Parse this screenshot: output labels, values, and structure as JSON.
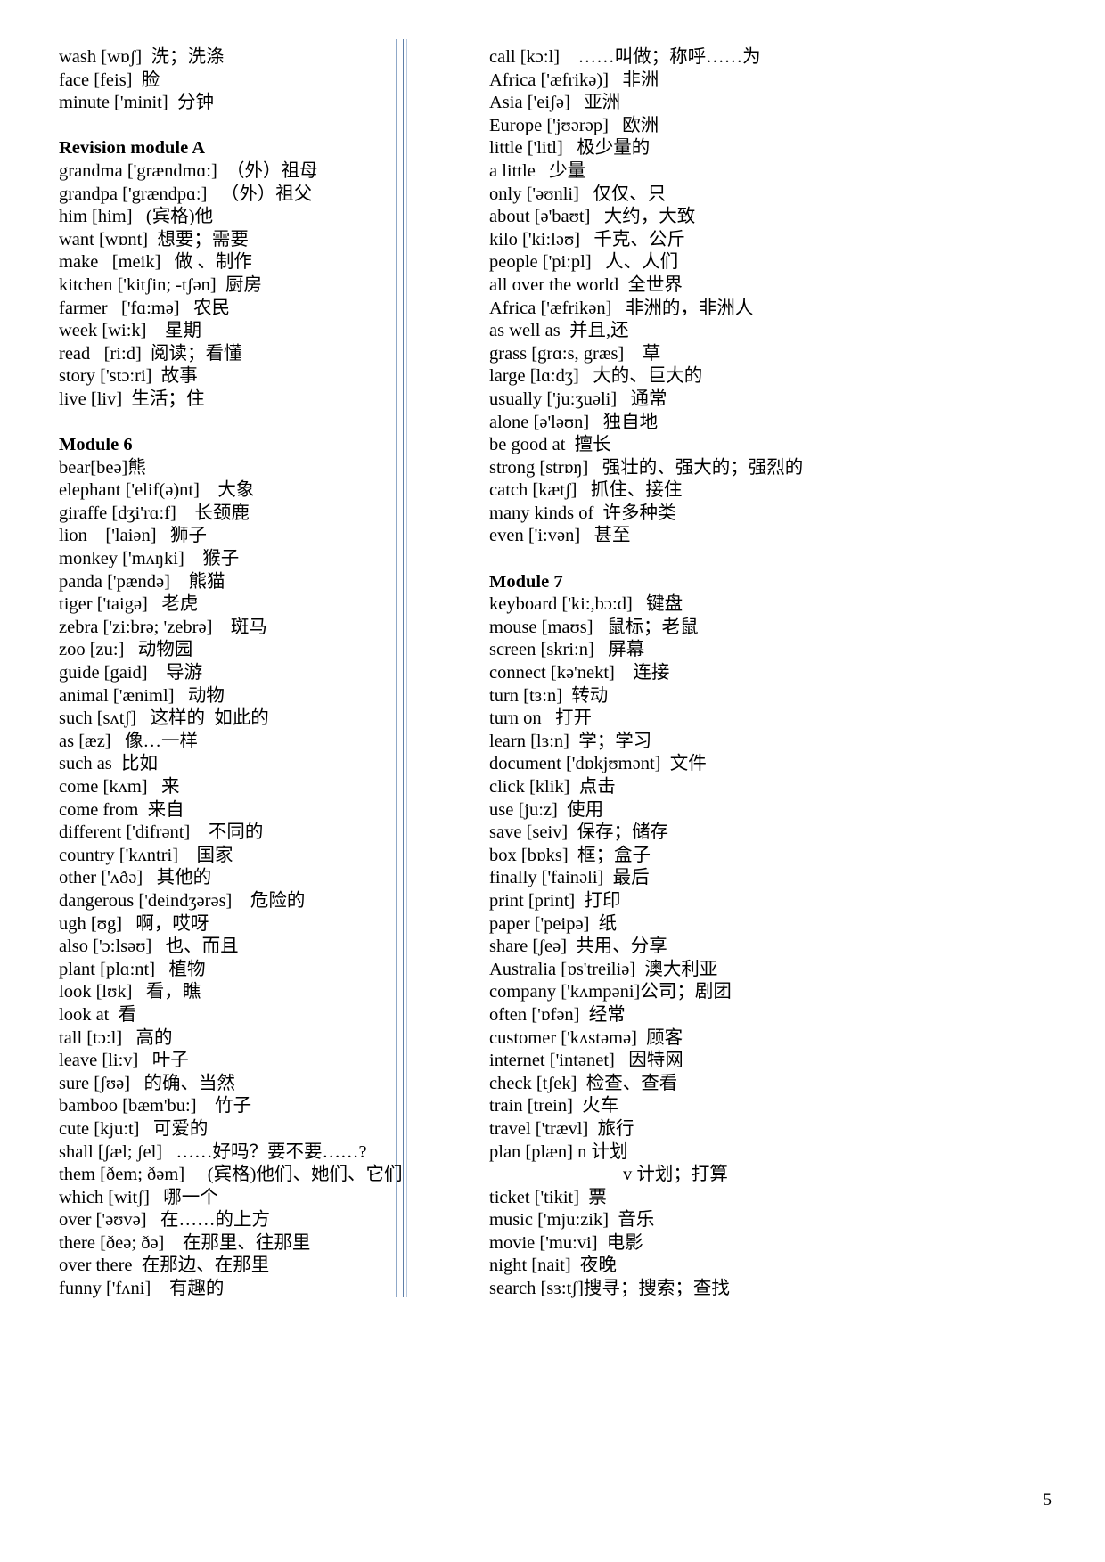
{
  "document": {
    "page_number": "5",
    "left_column": [
      {
        "type": "entry",
        "text": "wash [wɒʃ]  洗；洗涤"
      },
      {
        "type": "entry",
        "text": "face [feis]  脸"
      },
      {
        "type": "entry",
        "text": "minute ['minit]  分钟"
      },
      {
        "type": "spacer",
        "text": ""
      },
      {
        "type": "heading",
        "text": "Revision module A"
      },
      {
        "type": "entry",
        "text": "grandma ['grændmɑ:]  （外）祖母"
      },
      {
        "type": "entry",
        "text": "grandpa ['grændpɑ:]   （外）祖父"
      },
      {
        "type": "entry",
        "text": "him [him]   (宾格)他"
      },
      {
        "type": "entry",
        "text": "want [wɒnt]  想要；需要"
      },
      {
        "type": "entry",
        "text": "make   [meik]   做 、制作"
      },
      {
        "type": "entry",
        "text": "kitchen ['kitʃin; -tʃən]  厨房"
      },
      {
        "type": "entry",
        "text": "farmer   ['fɑ:mə]   农民"
      },
      {
        "type": "entry",
        "text": "week [wi:k]    星期"
      },
      {
        "type": "entry",
        "text": "read   [ri:d]  阅读；看懂"
      },
      {
        "type": "entry",
        "text": "story ['stɔ:ri]  故事"
      },
      {
        "type": "entry",
        "text": "live [liv]  生活；住"
      },
      {
        "type": "spacer",
        "text": ""
      },
      {
        "type": "heading",
        "text": "Module 6"
      },
      {
        "type": "entry",
        "text": "bear[beə]熊"
      },
      {
        "type": "entry",
        "text": "elephant ['elif(ə)nt]    大象"
      },
      {
        "type": "entry",
        "text": "giraffe [dʒi'rɑ:f]    长颈鹿"
      },
      {
        "type": "entry",
        "text": "lion    ['laiən]   狮子"
      },
      {
        "type": "entry",
        "text": "monkey ['mʌŋki]    猴子"
      },
      {
        "type": "entry",
        "text": "panda ['pændə]    熊猫"
      },
      {
        "type": "entry",
        "text": "tiger ['taigə]   老虎"
      },
      {
        "type": "entry",
        "text": "zebra ['zi:brə; 'zebrə]    斑马"
      },
      {
        "type": "entry",
        "text": "zoo [zu:]   动物园"
      },
      {
        "type": "entry",
        "text": "guide [gaid]    导游"
      },
      {
        "type": "entry",
        "text": "animal ['æniml]   动物"
      },
      {
        "type": "entry",
        "text": "such [sʌtʃ]   这样的  如此的"
      },
      {
        "type": "entry",
        "text": "as [æz]   像…一样"
      },
      {
        "type": "entry",
        "text": "such as  比如"
      },
      {
        "type": "entry",
        "text": "come [kʌm]   来"
      },
      {
        "type": "entry",
        "text": "come from  来自"
      },
      {
        "type": "entry",
        "text": "different ['difrənt]    不同的"
      },
      {
        "type": "entry",
        "text": "country ['kʌntri]    国家"
      },
      {
        "type": "entry",
        "text": "other ['ʌðə]   其他的"
      },
      {
        "type": "entry",
        "text": "dangerous ['deindʒərəs]    危险的"
      },
      {
        "type": "entry",
        "text": "ugh [ʊg]   啊，哎呀"
      },
      {
        "type": "entry",
        "text": "also ['ɔ:lsəʊ]   也、而且"
      },
      {
        "type": "entry",
        "text": "plant [plɑ:nt]   植物"
      },
      {
        "type": "entry",
        "text": "look [lʊk]   看，瞧"
      },
      {
        "type": "entry",
        "text": "look at  看"
      },
      {
        "type": "entry",
        "text": "tall [tɔ:l]   高的"
      },
      {
        "type": "entry",
        "text": "leave [li:v]   叶子"
      },
      {
        "type": "entry",
        "text": "sure [ʃʊə]   的确、当然"
      },
      {
        "type": "entry",
        "text": "bamboo [bæm'bu:]    竹子"
      },
      {
        "type": "entry",
        "text": "cute [kju:t]   可爱的"
      },
      {
        "type": "entry",
        "text": "shall [ʃæl; ʃel]   ……好吗？要不要……?"
      },
      {
        "type": "entry",
        "text": "them [ðem; ðəm]     (宾格)他们、她们、它们"
      },
      {
        "type": "entry",
        "text": "which [witʃ]   哪一个"
      },
      {
        "type": "entry",
        "text": "over ['əʊvə]   在……的上方"
      },
      {
        "type": "entry",
        "text": "there [ðeə; ðə]    在那里、往那里"
      },
      {
        "type": "entry",
        "text": "over there  在那边、在那里"
      },
      {
        "type": "entry",
        "text": "funny ['fʌni]    有趣的"
      }
    ],
    "right_column": [
      {
        "type": "entry",
        "text": "call [kɔ:l]    ……叫做；称呼……为"
      },
      {
        "type": "entry",
        "text": "Africa ['æfrikə)]   非洲"
      },
      {
        "type": "entry",
        "text": "Asia ['eiʃə]   亚洲"
      },
      {
        "type": "entry",
        "text": "Europe ['jʊərəp]   欧洲"
      },
      {
        "type": "entry",
        "text": "little ['litl]   极少量的"
      },
      {
        "type": "entry",
        "text": "a little   少量"
      },
      {
        "type": "entry",
        "text": "only ['əʊnli]   仅仅、只"
      },
      {
        "type": "entry",
        "text": "about [ə'baʊt]   大约，大致"
      },
      {
        "type": "entry",
        "text": "kilo ['ki:ləʊ]   千克、公斤"
      },
      {
        "type": "entry",
        "text": "people ['pi:pl]   人、人们"
      },
      {
        "type": "entry",
        "text": "all over the world  全世界"
      },
      {
        "type": "entry",
        "text": "Africa ['æfrikən]   非洲的，非洲人"
      },
      {
        "type": "entry",
        "text": "as well as  并且,还"
      },
      {
        "type": "entry",
        "text": "grass [grɑ:s, græs]    草"
      },
      {
        "type": "entry",
        "text": "large [lɑ:dʒ]   大的、巨大的"
      },
      {
        "type": "entry",
        "text": "usually ['ju:ʒuəli]   通常"
      },
      {
        "type": "entry",
        "text": "alone [ə'ləʊn]   独自地"
      },
      {
        "type": "entry",
        "text": "be good at  擅长"
      },
      {
        "type": "entry",
        "text": "strong [strɒŋ]   强壮的、强大的；强烈的"
      },
      {
        "type": "entry",
        "text": "catch [kætʃ]   抓住、接住"
      },
      {
        "type": "entry",
        "text": "many kinds of  许多种类"
      },
      {
        "type": "entry",
        "text": "even ['i:vən]   甚至"
      },
      {
        "type": "spacer",
        "text": ""
      },
      {
        "type": "heading",
        "text": "Module 7"
      },
      {
        "type": "entry",
        "text": "keyboard ['ki:,bɔ:d]   键盘"
      },
      {
        "type": "entry",
        "text": "mouse [maʊs]   鼠标；老鼠"
      },
      {
        "type": "entry",
        "text": "screen [skri:n]   屏幕"
      },
      {
        "type": "entry",
        "text": "connect [kə'nekt]    连接"
      },
      {
        "type": "entry",
        "text": "turn [tɜ:n]  转动"
      },
      {
        "type": "entry",
        "text": "turn on   打开"
      },
      {
        "type": "entry",
        "text": "learn [lɜ:n]  学；学习"
      },
      {
        "type": "entry",
        "text": "document ['dɒkjʊmənt]  文件"
      },
      {
        "type": "entry",
        "text": "click [klik]  点击"
      },
      {
        "type": "entry",
        "text": "use [ju:z]  使用"
      },
      {
        "type": "entry",
        "text": "save [seiv]  保存；储存"
      },
      {
        "type": "entry",
        "text": "box [bɒks]  框；盒子"
      },
      {
        "type": "entry",
        "text": "finally ['fainəli]  最后"
      },
      {
        "type": "entry",
        "text": "print [print]  打印"
      },
      {
        "type": "entry",
        "text": "paper ['peipə]  纸"
      },
      {
        "type": "entry",
        "text": "share [ʃeə]  共用、分享"
      },
      {
        "type": "entry",
        "text": "Australia [ɒs'treiliə]  澳大利亚"
      },
      {
        "type": "entry",
        "text": "company ['kʌmpəni]公司；剧团"
      },
      {
        "type": "entry",
        "text": "often ['ɒfən]  经常"
      },
      {
        "type": "entry",
        "text": "customer ['kʌstəmə]  顾客"
      },
      {
        "type": "entry",
        "text": "internet ['intənet]   因特网"
      },
      {
        "type": "entry",
        "text": "check [tʃek]  检查、查看"
      },
      {
        "type": "entry",
        "text": "train [trein]  火车"
      },
      {
        "type": "entry",
        "text": "travel ['trævl]  旅行"
      },
      {
        "type": "entry",
        "text": "plan [plæn] n 计划"
      },
      {
        "type": "cont",
        "text": "v 计划；打算"
      },
      {
        "type": "entry",
        "text": "ticket ['tikit]  票"
      },
      {
        "type": "entry",
        "text": "music ['mju:zik]  音乐"
      },
      {
        "type": "entry",
        "text": "movie ['mu:vi]  电影"
      },
      {
        "type": "entry",
        "text": "night [nait]  夜晚"
      },
      {
        "type": "entry",
        "text": "search [sɜ:tʃ]搜寻；搜索；查找"
      }
    ]
  }
}
